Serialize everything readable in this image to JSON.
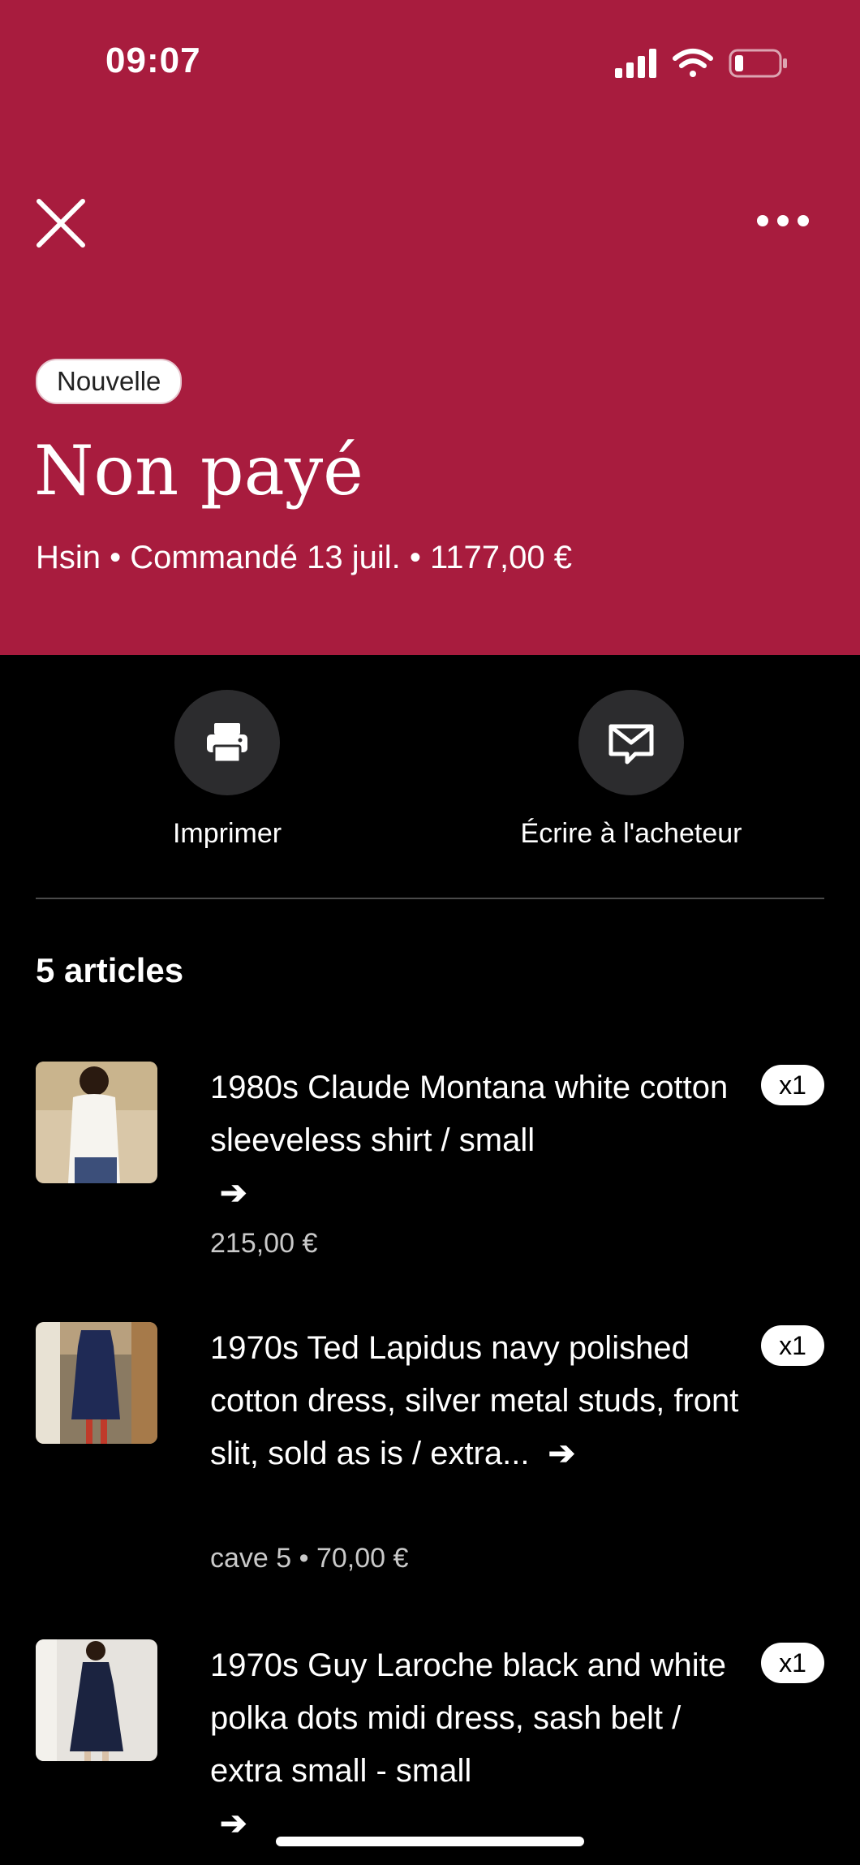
{
  "status_bar": {
    "time": "09:07"
  },
  "header": {
    "close_icon": "close-icon",
    "more_icon": "more-horizontal-icon",
    "badge": "Nouvelle",
    "title": "Non payé",
    "subtitle": "Hsin • Commandé 13 juil. • 1177,00 €",
    "background_color": "#a81c3e"
  },
  "actions": [
    {
      "label": "Imprimer",
      "icon": "printer-icon"
    },
    {
      "label": "Écrire à l'acheteur",
      "icon": "message-icon"
    }
  ],
  "items_section": {
    "title": "5 articles",
    "items": [
      {
        "title": "1980s Claude Montana white cotton sleeveless shirt / small",
        "meta": "215,00 €",
        "qty": "x1"
      },
      {
        "title": "1970s Ted Lapidus navy polished cotton dress, silver metal studs, front slit, sold as is / extra...",
        "meta": "cave 5 • 70,00 €",
        "qty": "x1"
      },
      {
        "title": "1970s Guy Laroche black and white polka dots midi dress, sash belt / extra small - small",
        "meta": "",
        "qty": "x1"
      }
    ]
  }
}
